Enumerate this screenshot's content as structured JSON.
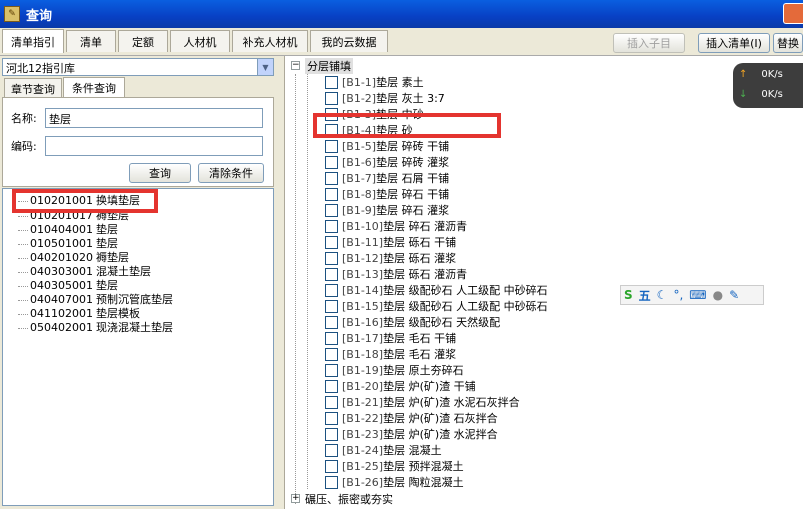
{
  "window": {
    "title": "查询"
  },
  "tabs": [
    {
      "label": "清单指引",
      "active": true
    },
    {
      "label": "清单",
      "active": false
    },
    {
      "label": "定额",
      "active": false
    },
    {
      "label": "人材机",
      "active": false
    },
    {
      "label": "补充人材机",
      "active": false
    },
    {
      "label": "我的云数据",
      "active": false
    }
  ],
  "toolbar": {
    "insert_child": "插入子目",
    "insert_list": "插入清单(I)",
    "replace": "替换"
  },
  "library": {
    "selected": "河北12指引库"
  },
  "subtabs": [
    {
      "label": "章节查询",
      "active": false
    },
    {
      "label": "条件查询",
      "active": true
    }
  ],
  "search": {
    "name_label": "名称:",
    "name_value": "垫层",
    "code_label": "编码:",
    "code_value": "",
    "query_button": "查询",
    "clear_button": "清除条件"
  },
  "results": [
    {
      "code": "010201001",
      "name": "换填垫层"
    },
    {
      "code": "010201017",
      "name": "褥垫层"
    },
    {
      "code": "010404001",
      "name": "垫层"
    },
    {
      "code": "010501001",
      "name": "垫层"
    },
    {
      "code": "040201020",
      "name": "褥垫层"
    },
    {
      "code": "040303001",
      "name": "混凝土垫层"
    },
    {
      "code": "040305001",
      "name": "垫层"
    },
    {
      "code": "040407001",
      "name": "预制沉管底垫层"
    },
    {
      "code": "041102001",
      "name": "垫层模板"
    },
    {
      "code": "050402001",
      "name": "现浇混凝土垫层"
    }
  ],
  "tree": {
    "root": "分层铺填",
    "items": [
      {
        "code": "[B1-1]",
        "name": "垫层 素土"
      },
      {
        "code": "[B1-2]",
        "name": "垫层 灰土 3:7"
      },
      {
        "code": "[B1-3]",
        "name": "垫层 中砂"
      },
      {
        "code": "[B1-4]",
        "name": "垫层 砂"
      },
      {
        "code": "[B1-5]",
        "name": "垫层 碎砖 干铺"
      },
      {
        "code": "[B1-6]",
        "name": "垫层 碎砖 灌浆"
      },
      {
        "code": "[B1-7]",
        "name": "垫层 石屑 干铺"
      },
      {
        "code": "[B1-8]",
        "name": "垫层 碎石 干铺"
      },
      {
        "code": "[B1-9]",
        "name": "垫层 碎石 灌浆"
      },
      {
        "code": "[B1-10]",
        "name": "垫层 碎石 灌沥青"
      },
      {
        "code": "[B1-11]",
        "name": "垫层 砾石 干铺"
      },
      {
        "code": "[B1-12]",
        "name": "垫层 砾石 灌浆"
      },
      {
        "code": "[B1-13]",
        "name": "垫层 砾石 灌沥青"
      },
      {
        "code": "[B1-14]",
        "name": "垫层 级配砂石 人工级配 中砂碎石"
      },
      {
        "code": "[B1-15]",
        "name": "垫层 级配砂石 人工级配 中砂砾石"
      },
      {
        "code": "[B1-16]",
        "name": "垫层 级配砂石 天然级配"
      },
      {
        "code": "[B1-17]",
        "name": "垫层 毛石 干铺"
      },
      {
        "code": "[B1-18]",
        "name": "垫层 毛石 灌浆"
      },
      {
        "code": "[B1-19]",
        "name": "垫层 原土夯碎石"
      },
      {
        "code": "[B1-20]",
        "name": "垫层 炉(矿)渣 干铺"
      },
      {
        "code": "[B1-21]",
        "name": "垫层 炉(矿)渣 水泥石灰拌合"
      },
      {
        "code": "[B1-22]",
        "name": "垫层 炉(矿)渣 石灰拌合"
      },
      {
        "code": "[B1-23]",
        "name": "垫层 炉(矿)渣 水泥拌合"
      },
      {
        "code": "[B1-24]",
        "name": "垫层 混凝土"
      },
      {
        "code": "[B1-25]",
        "name": "垫层 预拌混凝土"
      },
      {
        "code": "[B1-26]",
        "name": "垫层 陶粒混凝土"
      }
    ],
    "next_group": "碾压、振密或夯实"
  },
  "net_widget": {
    "up": "0K/s",
    "down": "0K/s"
  },
  "colors": {
    "highlight": "#e4342f",
    "titlebar": "#0a5fe0"
  }
}
